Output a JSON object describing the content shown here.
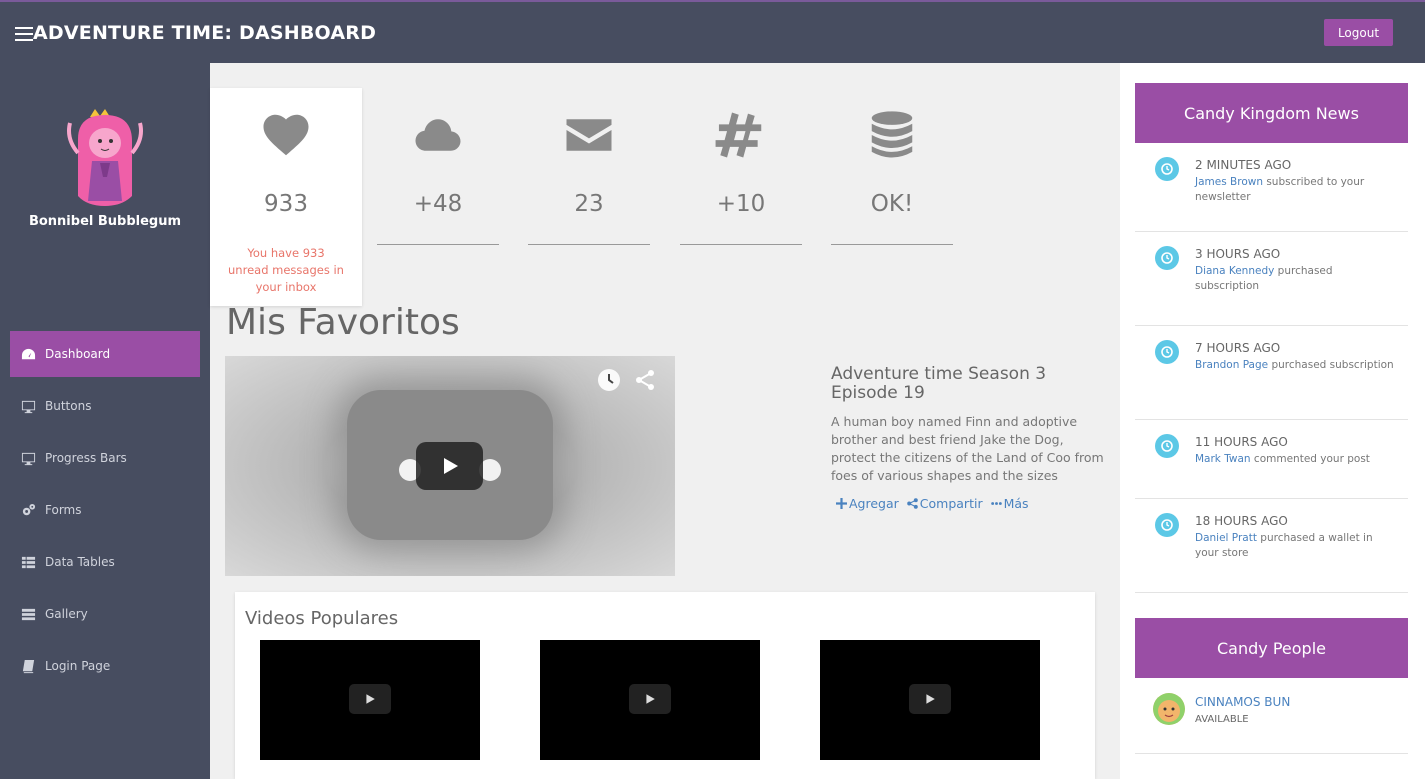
{
  "header": {
    "title": "ADVENTURE TIME: DASHBOARD",
    "logout_label": "Logout"
  },
  "profile": {
    "name": "Bonnibel Bubblegum"
  },
  "sidebar": {
    "items": [
      {
        "label": "Dashboard",
        "icon": "dashboard-icon",
        "active": true
      },
      {
        "label": "Buttons",
        "icon": "monitor-icon",
        "active": false
      },
      {
        "label": "Progress Bars",
        "icon": "monitor-icon",
        "active": false
      },
      {
        "label": "Forms",
        "icon": "gears-icon",
        "active": false
      },
      {
        "label": "Data Tables",
        "icon": "grid-icon",
        "active": false
      },
      {
        "label": "Gallery",
        "icon": "list-icon",
        "active": false
      },
      {
        "label": "Login Page",
        "icon": "book-icon",
        "active": false
      }
    ]
  },
  "stats": [
    {
      "icon": "heart-icon",
      "value": "933",
      "description": "You have 933 unread messages in your inbox"
    },
    {
      "icon": "cloud-icon",
      "value": "+48"
    },
    {
      "icon": "envelope-icon",
      "value": "23"
    },
    {
      "icon": "hashtag-icon",
      "value": "+10"
    },
    {
      "icon": "database-icon",
      "value": "OK!"
    }
  ],
  "favorites": {
    "title": "Mis Favoritos",
    "video": {
      "title": "Adventure time Season 3 Episode 19",
      "description": "A human boy named Finn and adoptive brother and best friend Jake the Dog, protect the citizens of the Land of Coo from foes of various shapes and the sizes"
    },
    "actions": {
      "add": "Agregar",
      "share": "Compartir",
      "more": "Más"
    }
  },
  "popular": {
    "title": "Videos Populares"
  },
  "news": {
    "title": "Candy Kingdom News",
    "items": [
      {
        "time": "2 MINUTES AGO",
        "user": "James Brown",
        "text": " subscribed to your newsletter"
      },
      {
        "time": "3 HOURS AGO",
        "user": "Diana Kennedy",
        "text": " purchased subscription"
      },
      {
        "time": "7 HOURS AGO",
        "user": "Brandon Page",
        "text": " purchased subscription"
      },
      {
        "time": "11 HOURS AGO",
        "user": "Mark Twan",
        "text": " commented your post"
      },
      {
        "time": "18 HOURS AGO",
        "user": "Daniel Pratt",
        "text": " purchased a wallet in your store"
      }
    ]
  },
  "people": {
    "title": "Candy People",
    "items": [
      {
        "name": "CINNAMOS BUN",
        "status": "AVAILABLE"
      }
    ]
  },
  "colors": {
    "accent": "#9a4ea5",
    "topbar": "#474d60",
    "link": "#4a82bf",
    "alert": "#e8756a",
    "news_icon": "#5cc8e6"
  }
}
